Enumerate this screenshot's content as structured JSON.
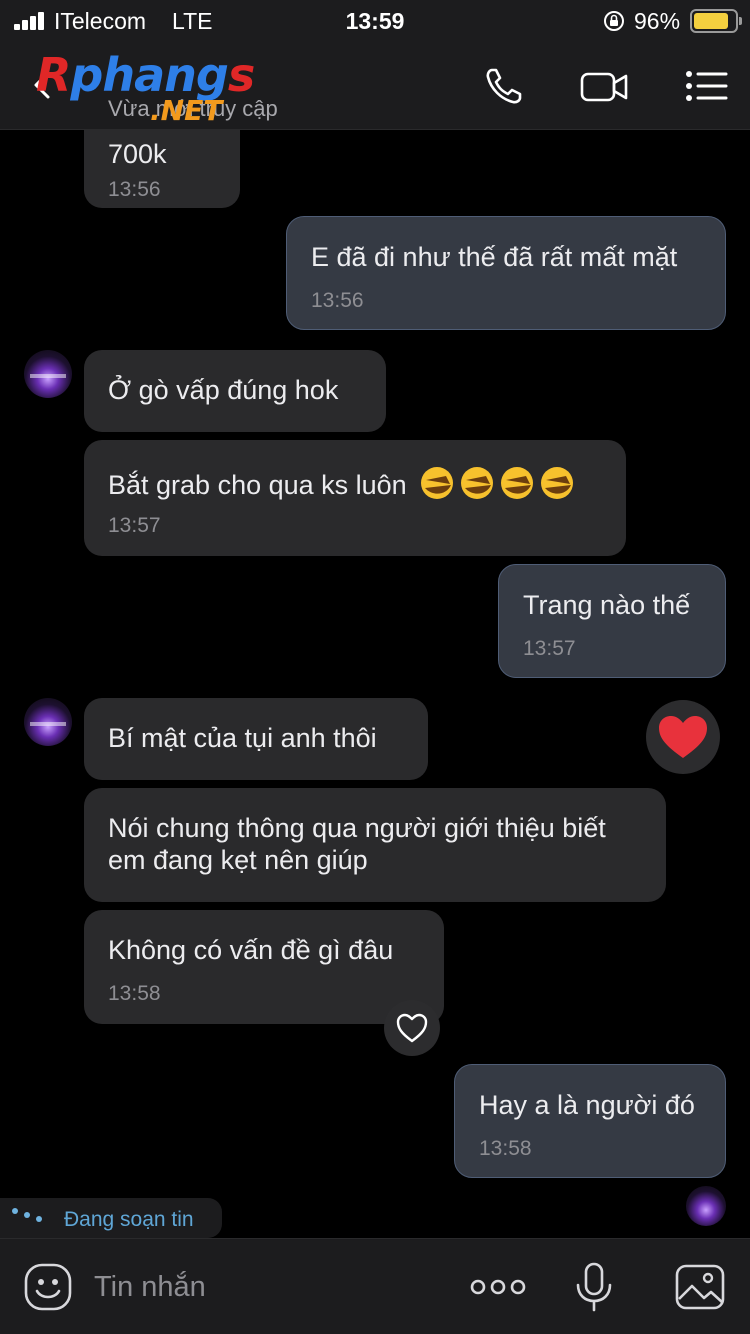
{
  "status_bar": {
    "carrier": "ITelecom",
    "network": "LTE",
    "time": "13:59",
    "battery_percent": "96%",
    "battery_level": 0.96
  },
  "header": {
    "contact_status": "Vừa mới truy cập",
    "watermark": {
      "part1": "R",
      "part2": "phang",
      "part3": "s",
      "tld": ".NET"
    },
    "icons": [
      "back-icon",
      "phone-icon",
      "video-camera-icon",
      "menu-icon"
    ]
  },
  "messages": [
    {
      "side": "in",
      "text": "700k",
      "time": "13:56"
    },
    {
      "side": "out",
      "text": "E đã đi như thế đã rất mất mặt",
      "time": "13:56"
    },
    {
      "side": "in",
      "text": "Ở gò vấp đúng hok",
      "time": ""
    },
    {
      "side": "in",
      "text": "Bắt grab cho qua ks luôn",
      "emoji_count": 4,
      "time": "13:57"
    },
    {
      "side": "out",
      "text": "Trang nào thế",
      "time": "13:57"
    },
    {
      "side": "in",
      "text": "Bí mật của tụi anh thôi",
      "time": "",
      "reaction": "heart"
    },
    {
      "side": "in",
      "text": [
        "Nói chung thông qua người giới thiệu biết",
        "em đang kẹt nên giúp"
      ],
      "time": ""
    },
    {
      "side": "in",
      "text": "Không có vấn đề gì đâu",
      "time": "13:58"
    },
    {
      "side": "out",
      "text": "Hay a là người đó",
      "time": "13:58"
    }
  ],
  "typing_indicator": "Đang soạn tin",
  "composer": {
    "placeholder": "Tin nhắn",
    "icons": [
      "sticker-icon",
      "more-icon",
      "microphone-icon",
      "image-icon"
    ]
  },
  "colors": {
    "background": "#000000",
    "incoming_bubble": "#2a2a2c",
    "outgoing_bubble": "#353a44",
    "outgoing_border": "#4f5d76",
    "heart": "#e8323c",
    "typing": "#5fa6d6"
  }
}
